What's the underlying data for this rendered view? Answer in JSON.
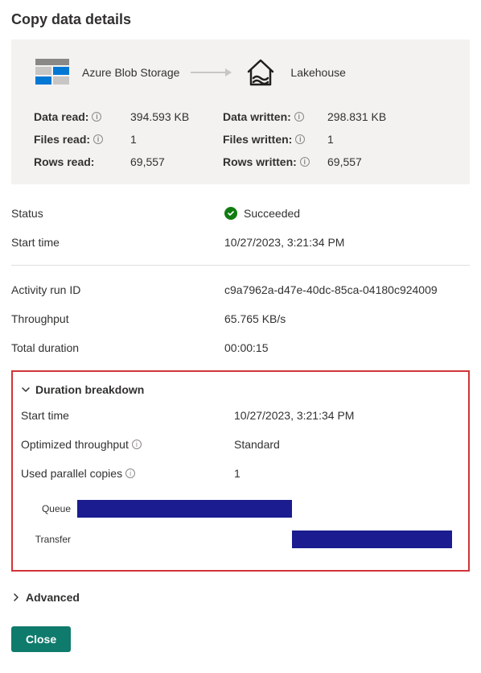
{
  "title": "Copy data details",
  "source": {
    "label": "Azure Blob Storage"
  },
  "sink": {
    "label": "Lakehouse"
  },
  "readStats": {
    "dataRead": {
      "label": "Data read:",
      "value": "394.593 KB"
    },
    "filesRead": {
      "label": "Files read:",
      "value": "1"
    },
    "rowsRead": {
      "label": "Rows read:",
      "value": "69,557"
    }
  },
  "writeStats": {
    "dataWritten": {
      "label": "Data written:",
      "value": "298.831 KB"
    },
    "filesWritten": {
      "label": "Files written:",
      "value": "1"
    },
    "rowsWritten": {
      "label": "Rows written:",
      "value": "69,557"
    }
  },
  "status": {
    "label": "Status",
    "value": "Succeeded"
  },
  "startTime": {
    "label": "Start time",
    "value": "10/27/2023, 3:21:34 PM"
  },
  "activityRunId": {
    "label": "Activity run ID",
    "value": "c9a7962a-d47e-40dc-85ca-04180c924009"
  },
  "throughput": {
    "label": "Throughput",
    "value": "65.765 KB/s"
  },
  "totalDuration": {
    "label": "Total duration",
    "value": "00:00:15"
  },
  "durationBreakdown": {
    "heading": "Duration breakdown",
    "startTime": {
      "label": "Start time",
      "value": "10/27/2023, 3:21:34 PM"
    },
    "optimizedThroughput": {
      "label": "Optimized throughput",
      "value": "Standard"
    },
    "usedParallelCopies": {
      "label": "Used parallel copies",
      "value": "1"
    },
    "bars": {
      "queue": {
        "label": "Queue",
        "startPct": 0,
        "widthPct": 56
      },
      "transfer": {
        "label": "Transfer",
        "startPct": 56,
        "widthPct": 42
      }
    }
  },
  "advanced": {
    "label": "Advanced"
  },
  "closeButton": "Close",
  "colors": {
    "bar": "#1a1c8f",
    "highlight": "#d13438",
    "primaryBtn": "#0f7b6c",
    "success": "#107c10"
  }
}
